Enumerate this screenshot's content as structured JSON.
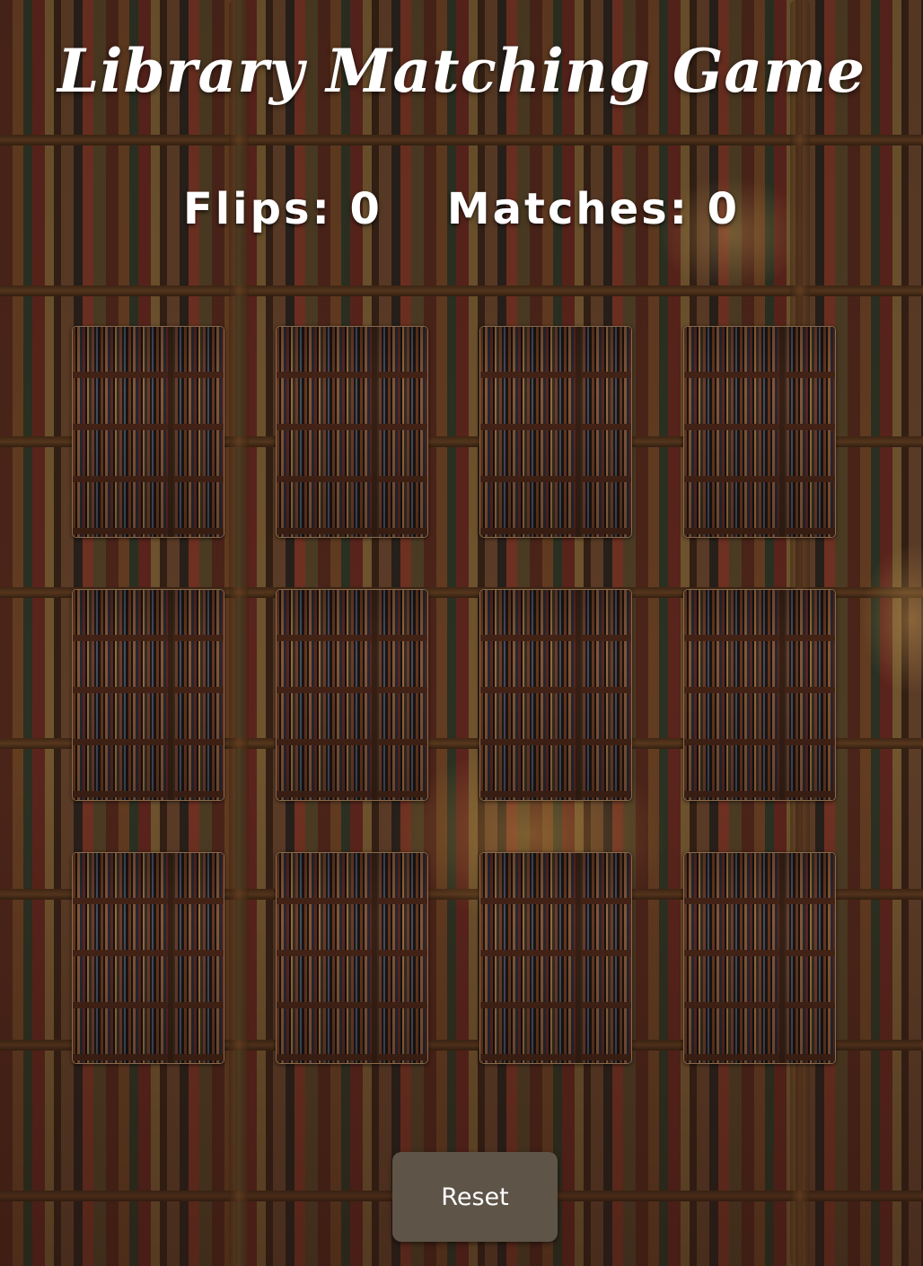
{
  "title": "Library Matching Game",
  "stats": {
    "flips_label": "Flips: ",
    "flips_value": "0",
    "matches_label": "Matches: ",
    "matches_value": "0"
  },
  "board": {
    "rows": 3,
    "columns": 4,
    "cards": [
      {
        "state": "face-down",
        "back_icon": "bookshelf-icon"
      },
      {
        "state": "face-down",
        "back_icon": "bookshelf-icon"
      },
      {
        "state": "face-down",
        "back_icon": "bookshelf-icon"
      },
      {
        "state": "face-down",
        "back_icon": "bookshelf-icon"
      },
      {
        "state": "face-down",
        "back_icon": "bookshelf-icon"
      },
      {
        "state": "face-down",
        "back_icon": "bookshelf-icon"
      },
      {
        "state": "face-down",
        "back_icon": "bookshelf-icon"
      },
      {
        "state": "face-down",
        "back_icon": "bookshelf-icon"
      },
      {
        "state": "face-down",
        "back_icon": "bookshelf-icon"
      },
      {
        "state": "face-down",
        "back_icon": "bookshelf-icon"
      },
      {
        "state": "face-down",
        "back_icon": "bookshelf-icon"
      },
      {
        "state": "face-down",
        "back_icon": "bookshelf-icon"
      }
    ]
  },
  "reset_button": {
    "label": "Reset"
  },
  "colors": {
    "title_text": "#ffffff",
    "button_bg": "#5e5448",
    "button_text": "#ffffff",
    "background": "#3a2616"
  }
}
